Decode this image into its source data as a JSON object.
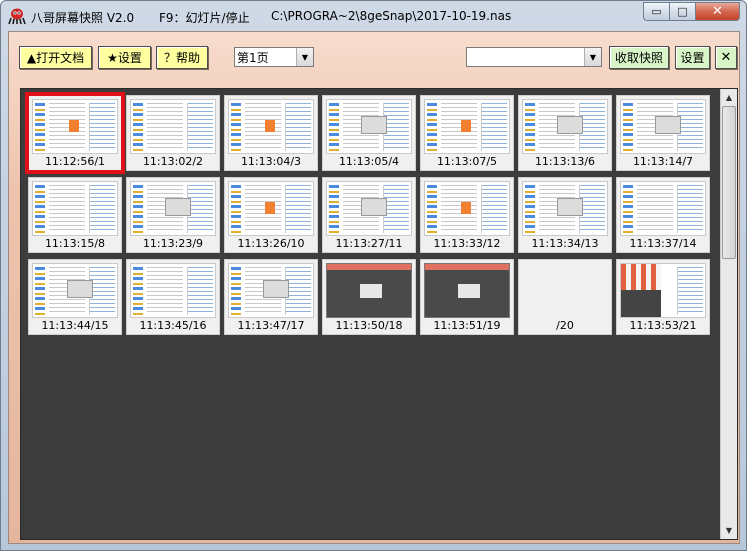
{
  "window": {
    "app_title": "八哥屏幕快照 V2.0",
    "hotkey_hint": "F9：幻灯片/停止",
    "file_path": "C:\\PROGRA~2\\8geSnap\\2017-10-19.nas",
    "min_glyph": "▭",
    "max_glyph": "□",
    "close_glyph": "✕"
  },
  "toolbar": {
    "open_doc": "▲打开文档",
    "settings": "★设置",
    "help": "？帮助",
    "page_select": "第1页",
    "right_select": "",
    "collect": "收取快照",
    "settings2": "设置",
    "close": "✕",
    "dropdown_glyph": "▼"
  },
  "thumbnails": [
    {
      "label": "11:12:56/1",
      "kind": "desktop-orange",
      "selected": true
    },
    {
      "label": "11:13:02/2",
      "kind": "desktop",
      "selected": false
    },
    {
      "label": "11:13:04/3",
      "kind": "desktop-orange",
      "selected": false
    },
    {
      "label": "11:13:05/4",
      "kind": "desktop-dialog",
      "selected": false
    },
    {
      "label": "11:13:07/5",
      "kind": "desktop-orange",
      "selected": false
    },
    {
      "label": "11:13:13/6",
      "kind": "desktop-dialog",
      "selected": false
    },
    {
      "label": "11:13:14/7",
      "kind": "desktop-dialog",
      "selected": false
    },
    {
      "label": "11:13:15/8",
      "kind": "desktop",
      "selected": false
    },
    {
      "label": "11:13:23/9",
      "kind": "desktop-dialog",
      "selected": false
    },
    {
      "label": "11:13:26/10",
      "kind": "desktop-orange",
      "selected": false
    },
    {
      "label": "11:13:27/11",
      "kind": "desktop-dialog",
      "selected": false
    },
    {
      "label": "11:13:33/12",
      "kind": "desktop-orange",
      "selected": false
    },
    {
      "label": "11:13:34/13",
      "kind": "desktop-dialog",
      "selected": false
    },
    {
      "label": "11:13:37/14",
      "kind": "desktop",
      "selected": false
    },
    {
      "label": "11:13:44/15",
      "kind": "desktop-dialog",
      "selected": false
    },
    {
      "label": "11:13:45/16",
      "kind": "desktop",
      "selected": false
    },
    {
      "label": "11:13:47/17",
      "kind": "desktop-dialog",
      "selected": false
    },
    {
      "label": "11:13:50/18",
      "kind": "dark",
      "selected": false
    },
    {
      "label": "11:13:51/19",
      "kind": "dark",
      "selected": false
    },
    {
      "label": "/20",
      "kind": "blank",
      "selected": false
    },
    {
      "label": "11:13:53/21",
      "kind": "mixed",
      "selected": false
    }
  ],
  "scrollbar": {
    "up": "▲",
    "down": "▼"
  },
  "colors": {
    "selection": "#e0101a",
    "button_yellow": "#ffffa0",
    "button_green": "#d8f5c8",
    "panel_bg": "#3c3c3c"
  }
}
